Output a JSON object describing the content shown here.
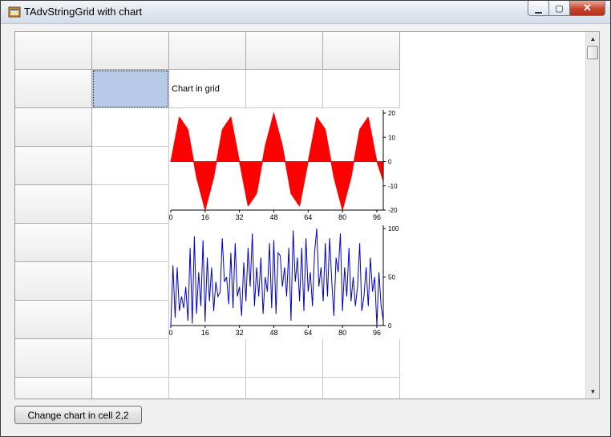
{
  "window": {
    "title": "TAdvStringGrid with chart",
    "caption_buttons": {
      "minimize": "▁",
      "maximize": "▢",
      "close": "✕"
    }
  },
  "grid": {
    "cell_1_2_text": "Chart in grid",
    "selected_cell": "1,1"
  },
  "chart_data": [
    {
      "type": "area",
      "series": [
        {
          "x": [
            0,
            4,
            8,
            12,
            16,
            20,
            24,
            28,
            32,
            36,
            40,
            44,
            48,
            52,
            56,
            60,
            64,
            68,
            72,
            76,
            80,
            84,
            88,
            92,
            96,
            99
          ],
          "values": [
            0,
            18.4,
            13.2,
            -6.5,
            -20,
            -6.5,
            13.2,
            18.4,
            0,
            -18.4,
            -13.2,
            6.5,
            20,
            6.5,
            -13.2,
            -18.4,
            0,
            18.4,
            13.2,
            -6.5,
            -20,
            -6.5,
            13.2,
            18.4,
            0,
            -8
          ],
          "color": "#ff0000"
        }
      ],
      "xticks": [
        "0",
        "16",
        "32",
        "48",
        "64",
        "80",
        "96"
      ],
      "yticks": [
        "20",
        "10",
        "0",
        "-10",
        "-20"
      ],
      "xlim": [
        0,
        99
      ],
      "ylim": [
        -20,
        20
      ],
      "yaxis_position": "right"
    },
    {
      "type": "line",
      "series": [
        {
          "values": [
            0,
            62,
            8,
            60,
            15,
            30,
            18,
            40,
            5,
            80,
            2,
            92,
            12,
            55,
            20,
            88,
            4,
            70,
            25,
            60,
            15,
            45,
            30,
            35,
            90,
            45,
            50,
            22,
            75,
            18,
            85,
            30,
            40,
            10,
            65,
            25,
            80,
            40,
            95,
            20,
            60,
            30,
            70,
            12,
            50,
            35,
            85,
            18,
            88,
            12,
            75,
            72,
            40,
            60,
            30,
            80,
            5,
            98,
            45,
            70,
            25,
            80,
            15,
            90,
            35,
            55,
            20,
            75,
            100,
            40,
            60,
            25,
            85,
            30,
            90,
            45,
            10,
            70,
            55,
            95,
            15,
            60,
            30,
            80,
            25,
            50,
            20,
            40,
            85,
            15,
            30,
            60,
            20,
            70,
            35,
            50,
            0,
            55,
            20,
            5
          ],
          "color": "#0000cc"
        }
      ],
      "xticks": [
        "0",
        "16",
        "32",
        "48",
        "64",
        "80",
        "96"
      ],
      "yticks": [
        "100",
        "50",
        "0"
      ],
      "xlim": [
        0,
        99
      ],
      "ylim": [
        0,
        100
      ],
      "yaxis_position": "right"
    }
  ],
  "actions": {
    "change_chart_label": "Change chart in cell 2,2"
  },
  "scrollbar": {
    "up": "▲",
    "down": "▼"
  }
}
